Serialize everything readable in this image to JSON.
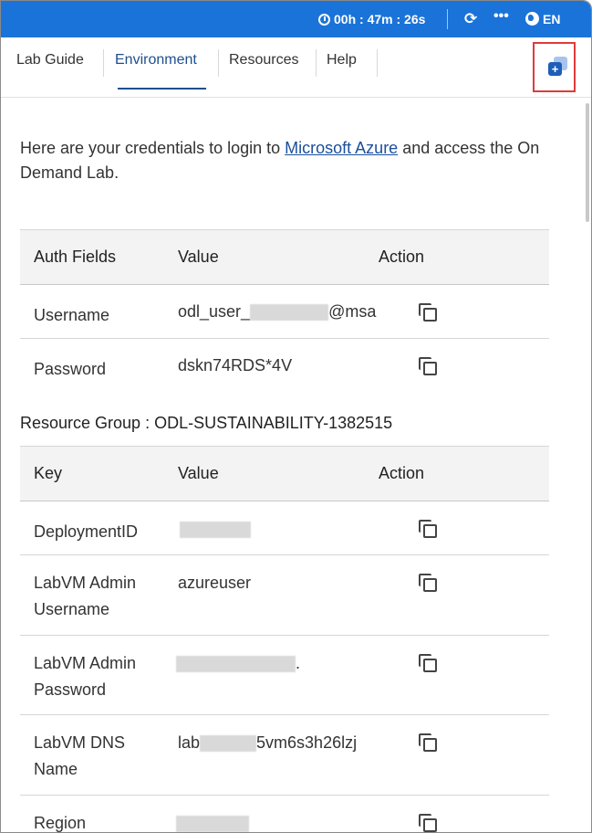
{
  "topbar": {
    "timer": "00h : 47m : 26s",
    "language": "EN",
    "icons": [
      "clock-icon",
      "refresh-icon",
      "more-icon",
      "globe-icon"
    ]
  },
  "tabs": [
    {
      "label": "Lab Guide",
      "active": false
    },
    {
      "label": "Environment",
      "active": true
    },
    {
      "label": "Resources",
      "active": false
    },
    {
      "label": "Help",
      "active": false
    }
  ],
  "intro": {
    "before": "Here are your credentials to login to ",
    "link": "Microsoft Azure",
    "after": " and access the On Demand Lab."
  },
  "credentials": {
    "headers": [
      "Auth Fields",
      "Value",
      "Action"
    ],
    "rows": [
      {
        "field": "Username",
        "value_prefix": "odl_user_",
        "value_suffix": "@msa"
      },
      {
        "field": "Password",
        "value": "dskn74RDS*4V"
      }
    ]
  },
  "resource_group": {
    "title": "Resource Group : ODL-SUSTAINABILITY-1382515",
    "headers": [
      "Key",
      "Value",
      "Action"
    ],
    "rows": [
      {
        "key": "DeploymentID",
        "value": ""
      },
      {
        "key": "LabVM Admin Username",
        "value": "azureuser"
      },
      {
        "key": "LabVM Admin Password",
        "value": "."
      },
      {
        "key": "LabVM DNS Name",
        "value_prefix": "lab",
        "value_suffix": "5vm6s3h26lzj"
      },
      {
        "key": "Region",
        "value": ""
      }
    ]
  },
  "colors": {
    "topbar": "#1a73d8",
    "active_tab": "#1e4f8f",
    "highlight_box": "#e03a3a",
    "link": "#1a4f9c"
  }
}
